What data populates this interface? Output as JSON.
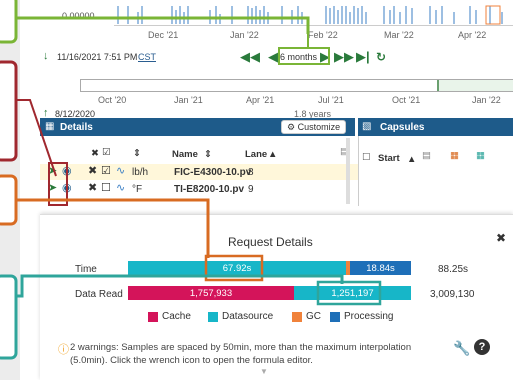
{
  "timeline": {
    "y_value": "0.00000",
    "months_top": [
      "Dec '21",
      "Jan '22",
      "Feb '22",
      "Mar '22",
      "Apr '22"
    ],
    "start_time": "11/16/2021 7:51 PM",
    "timezone": "CST",
    "duration": "6 months",
    "months_bottom": [
      "Oct '20",
      "Jan '21",
      "Apr '21",
      "Jul '21",
      "Oct '21",
      "Jan '22"
    ],
    "overview_start": "8/12/2020",
    "overview_span": "1.8 years"
  },
  "details": {
    "title": "Details",
    "customize_label": "Customize",
    "columns": {
      "name": "Name",
      "lane": "Lane"
    },
    "rows": [
      {
        "unit": "lb/h",
        "name": "FIC-E4300-10.pv",
        "lane": "8"
      },
      {
        "unit": "°F",
        "name": "TI-E8200-10.pv",
        "lane": "9"
      }
    ]
  },
  "capsules": {
    "title": "Capsules",
    "start_label": "Start"
  },
  "request": {
    "title": "Request Details",
    "time_label": "Time",
    "time_datasource": "67.92s",
    "time_processing": "18.84s",
    "time_total": "88.25s",
    "data_label": "Data Read",
    "data_cache": "1,757,933",
    "data_datasource": "1,251,197",
    "data_total": "3,009,130",
    "legend": [
      "Cache",
      "Datasource",
      "GC",
      "Processing"
    ],
    "warning": "2 warnings: Samples are spaced by 50min, more than the maximum interpolation (5.0min). Click the wrench icon to open the formula editor."
  },
  "colors": {
    "cache": "#d4145a",
    "datasource": "#17b6c8",
    "gc": "#f0823b",
    "processing": "#1e6fb8",
    "callout_green": "#7ab536",
    "callout_red": "#a0282f",
    "callout_orange": "#d86b22",
    "callout_teal": "#2fa59b"
  }
}
